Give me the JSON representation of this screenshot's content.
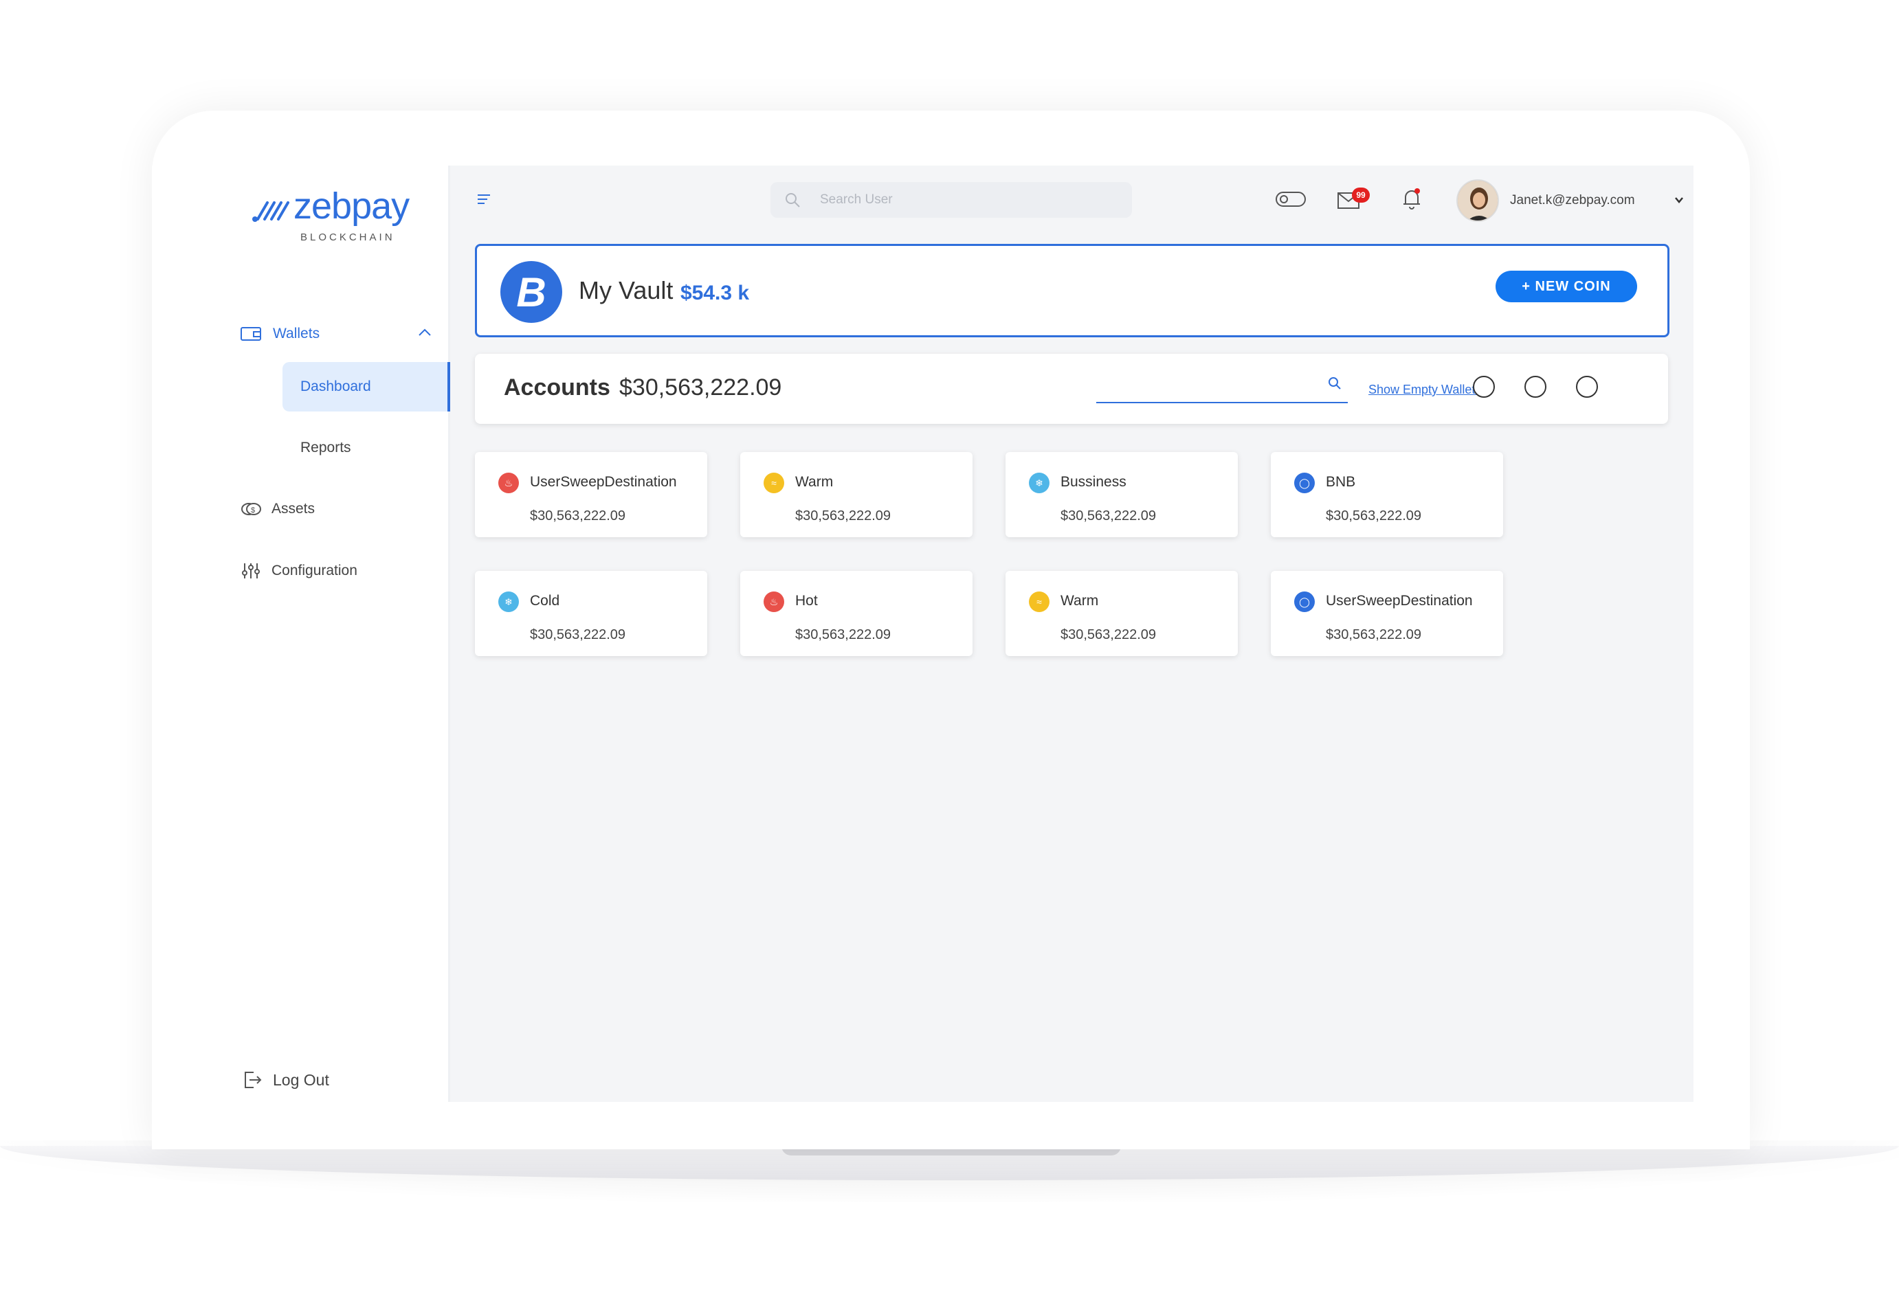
{
  "brand": {
    "name": "zebpay",
    "subtitle": "BLOCKCHAIN"
  },
  "sidebar": {
    "wallets_label": "Wallets",
    "dashboard_label": "Dashboard",
    "reports_label": "Reports",
    "assets_label": "Assets",
    "configuration_label": "Configuration",
    "logout_label": "Log Out"
  },
  "header": {
    "search_placeholder": "Search User",
    "mail_badge": "99",
    "user_email": "Janet.k@zebpay.com"
  },
  "vault": {
    "coin_symbol": "B",
    "title": "My Vault",
    "value": "$54.3 k",
    "new_coin_label": "+ NEW COIN"
  },
  "accounts": {
    "title": "Accounts",
    "total": "$30,563,222.09",
    "show_empty_label": "Show Empty Wallets"
  },
  "wallets": [
    {
      "name": "UserSweepDestination",
      "amount": "$30,563,222.09",
      "icon": "fire-icon",
      "color": "#e8514a"
    },
    {
      "name": "Warm",
      "amount": "$30,563,222.09",
      "icon": "warm-icon",
      "color": "#f5c022"
    },
    {
      "name": "Bussiness",
      "amount": "$30,563,222.09",
      "icon": "snowflake-icon",
      "color": "#4fb6e8"
    },
    {
      "name": "BNB",
      "amount": "$30,563,222.09",
      "icon": "shield-icon",
      "color": "#2f6fdc"
    },
    {
      "name": "Cold",
      "amount": "$30,563,222.09",
      "icon": "snowflake-icon",
      "color": "#4fb6e8"
    },
    {
      "name": "Hot",
      "amount": "$30,563,222.09",
      "icon": "fire-icon",
      "color": "#e8514a"
    },
    {
      "name": "Warm",
      "amount": "$30,563,222.09",
      "icon": "warm-icon",
      "color": "#f5c022"
    },
    {
      "name": "UserSweepDestination",
      "amount": "$30,563,222.09",
      "icon": "shield-icon",
      "color": "#2f6fdc"
    }
  ],
  "colors": {
    "accent": "#2f6fdc",
    "button": "#1478f0",
    "badge": "#e32020"
  }
}
